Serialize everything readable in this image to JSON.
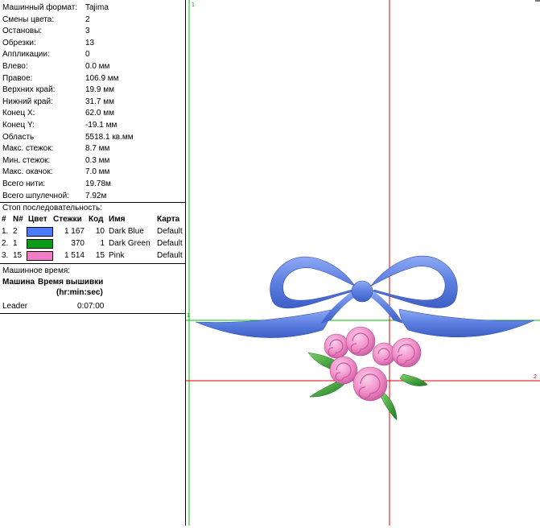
{
  "stats": [
    {
      "label": "Машинный формат:",
      "value": "Tajima"
    },
    {
      "label": "Смены цвета:",
      "value": "2"
    },
    {
      "label": "Остановы:",
      "value": "3"
    },
    {
      "label": "Обрезки:",
      "value": "13"
    },
    {
      "label": "Аппликации:",
      "value": "0"
    },
    {
      "label": "Влево:",
      "value": "0.0 мм"
    },
    {
      "label": "Правое:",
      "value": "106.9 мм"
    },
    {
      "label": "Верхних край:",
      "value": "19.9 мм"
    },
    {
      "label": "Нижний край:",
      "value": "31.7 мм"
    },
    {
      "label": "Конец X:",
      "value": "62.0 мм"
    },
    {
      "label": "Конец Y:",
      "value": "-19.1 мм"
    },
    {
      "label": "Область",
      "value": "5518.1 кв.мм"
    },
    {
      "label": "Макс. стежок:",
      "value": "8.7 мм"
    },
    {
      "label": "Мин. стежок:",
      "value": "0.3 мм"
    },
    {
      "label": "Макс. окачок:",
      "value": "7.0 мм"
    },
    {
      "label": "Всего нити:",
      "value": "19.78м"
    },
    {
      "label": "Всего шпулечной:",
      "value": "7.92м"
    }
  ],
  "stop_sequence": {
    "title": "Стоп последовательность:",
    "headers": {
      "idx": "#",
      "n": "N#",
      "color": "Цвет",
      "stitches": "Стежки",
      "code": "Код",
      "name": "Имя",
      "chart": "Карта"
    },
    "rows": [
      {
        "idx": "1.",
        "n": "2",
        "color": "#4b7bff",
        "stitches": "1 167",
        "code": "10",
        "name": "Dark Blue",
        "chart": "Default"
      },
      {
        "idx": "2.",
        "n": "1",
        "color": "#0a9a1a",
        "stitches": "370",
        "code": "1",
        "name": "Dark Green",
        "chart": "Default"
      },
      {
        "idx": "3.",
        "n": "15",
        "color": "#f57ac8",
        "stitches": "1 514",
        "code": "15",
        "name": "Pink",
        "chart": "Default"
      }
    ]
  },
  "machine_time": {
    "title": "Машинное время:",
    "header_machine": "Машина",
    "header_time": "Время вышивки",
    "header_units": "(hr:min:sec)",
    "rows": [
      {
        "machine": "Leader",
        "time": "0:07:00"
      }
    ]
  },
  "canvas": {
    "guide_label_top": "1",
    "guide_label_left": "1",
    "guide_label_right": "2",
    "guide_green": "#00c000",
    "guide_red": "#e00000",
    "thread_colors": {
      "bow": "#5b7fe0",
      "flower": "#f08cc8",
      "leaf": "#3aa03a"
    }
  }
}
